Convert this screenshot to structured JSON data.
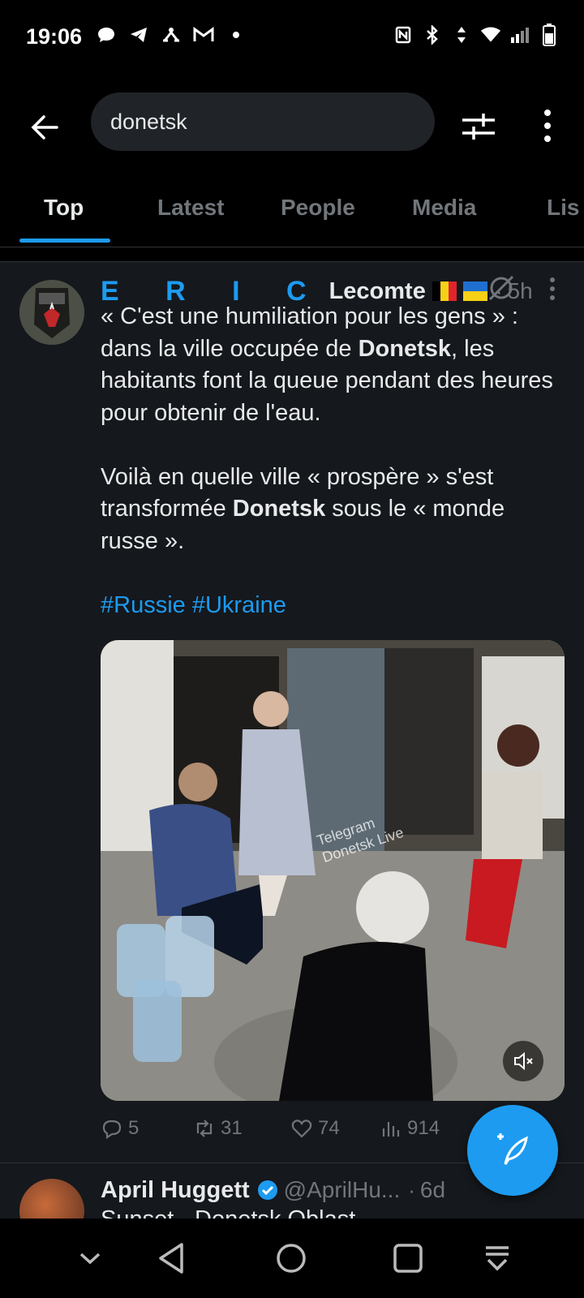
{
  "status_bar": {
    "time": "19:06",
    "left_icons": [
      "chat-bubble-icon",
      "telegram-icon",
      "network-icon",
      "gmail-icon",
      "dot-icon"
    ],
    "right_icons": [
      "nfc-icon",
      "bluetooth-icon",
      "data-arrows-icon",
      "wifi-icon",
      "signal-icon",
      "battery-icon"
    ]
  },
  "search": {
    "query": "donetsk"
  },
  "tabs": [
    {
      "label": "Top",
      "active": true
    },
    {
      "label": "Latest"
    },
    {
      "label": "People"
    },
    {
      "label": "Media"
    },
    {
      "label": "Lis"
    }
  ],
  "post1": {
    "name_prefix": "E R I C",
    "name_rest": "Lecomte",
    "flags": [
      "belgium-flag",
      "ukraine-flag"
    ],
    "time": "5h",
    "para1_a": "« C'est une humiliation pour les gens » : dans la ville occupée de ",
    "para1_bold": "Donetsk",
    "para1_b": ", les habitants font la queue pendant des heures pour obtenir de l'eau.",
    "para2_a": "Voilà en quelle ville « prospère » s'est transformée ",
    "para2_bold": "Donetsk",
    "para2_b": " sous le « monde russe ».",
    "hashtag1": "#Russie",
    "hashtag2": "#Ukraine",
    "video_watermark_line1": "Telegram",
    "video_watermark_line2": "Donetsk Live",
    "replies": "5",
    "reposts": "31",
    "likes": "74",
    "views": "914"
  },
  "post2": {
    "name": "April Huggett",
    "handle": "@AprilHu...",
    "time": "6d",
    "text_partial": "Sunset - Donetsk Oblast"
  },
  "colors": {
    "accent": "#1d9bf0",
    "background": "#15181c",
    "muted": "#71767b"
  }
}
